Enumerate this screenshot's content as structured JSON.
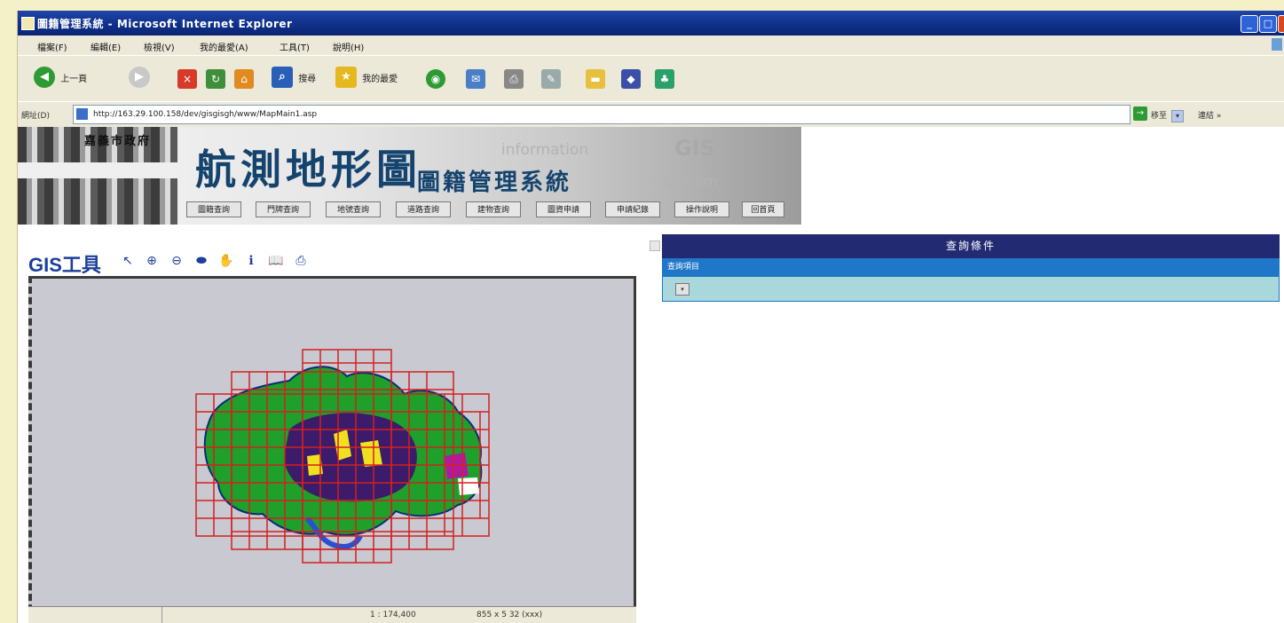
{
  "window": {
    "title": "圖籍管理系統 - Microsoft Internet Explorer",
    "min": "_",
    "max": "□",
    "close": "×"
  },
  "menu": {
    "items": [
      "檔案(F)",
      "編輯(E)",
      "檢視(V)",
      "我的最愛(A)",
      "工具(T)",
      "說明(H)"
    ]
  },
  "toolbar": {
    "back_label": "上一頁",
    "back_glyph": "◀",
    "forward_glyph": "▶",
    "stop_glyph": "×",
    "refresh_glyph": "↻",
    "home_glyph": "⌂",
    "search_label": "搜尋",
    "search_glyph": "⌕",
    "favorites_label": "我的最愛",
    "favorites_glyph": "★",
    "media_glyph": "◉",
    "mail_glyph": "✉",
    "print_glyph": "⎙",
    "edit_glyph": "✎",
    "folder_glyph": "▬",
    "messenger_glyph": "◆",
    "im_glyph": "♣"
  },
  "address": {
    "label": "網址(D)",
    "url": "http://163.29.100.158/dev/gisgisgh/www/MapMain1.asp",
    "dropdown_glyph": "▾",
    "go_glyph": "→",
    "go_label": "移至",
    "links_label": "連結 »"
  },
  "banner": {
    "org_name": "嘉義市政府",
    "title": "航測地形圖",
    "subtitle": "圖籍管理系統",
    "watermark_information": "information",
    "watermark_gis": "GIS",
    "watermark_system": "system"
  },
  "nav": {
    "items": [
      "圖籍查詢",
      "門牌查詢",
      "地號查詢",
      "道路查詢",
      "建物查詢",
      "圖資申請",
      "申請紀錄",
      "操作說明",
      "回首頁"
    ]
  },
  "gis_tools": {
    "label": "GIS工具",
    "tools": [
      {
        "name": "select",
        "glyph": "↖"
      },
      {
        "name": "zoom-in",
        "glyph": "⊕"
      },
      {
        "name": "zoom-out",
        "glyph": "⊖"
      },
      {
        "name": "full-extent",
        "glyph": "⬬"
      },
      {
        "name": "pan",
        "glyph": "✋"
      },
      {
        "name": "identify",
        "glyph": "ℹ"
      },
      {
        "name": "bookmarks",
        "glyph": "📖"
      },
      {
        "name": "print",
        "glyph": "⎙"
      }
    ]
  },
  "map": {
    "scale_text": "1 : 174,400",
    "coord_text": "855 x 5 32 (xxx)"
  },
  "panel": {
    "header": "查詢條件",
    "subheader": "查詢項目",
    "select_glyph": "▾"
  },
  "colors": {
    "titlebar": "#0f2f88",
    "panel_header": "#222b72",
    "panel_subheader": "#1f77c8",
    "panel_row": "#a9d8dc",
    "gis_blue": "#1b3f9c",
    "map_grid": "#d42020",
    "map_green": "#1ea02a",
    "map_background": "#c8c9d1"
  }
}
